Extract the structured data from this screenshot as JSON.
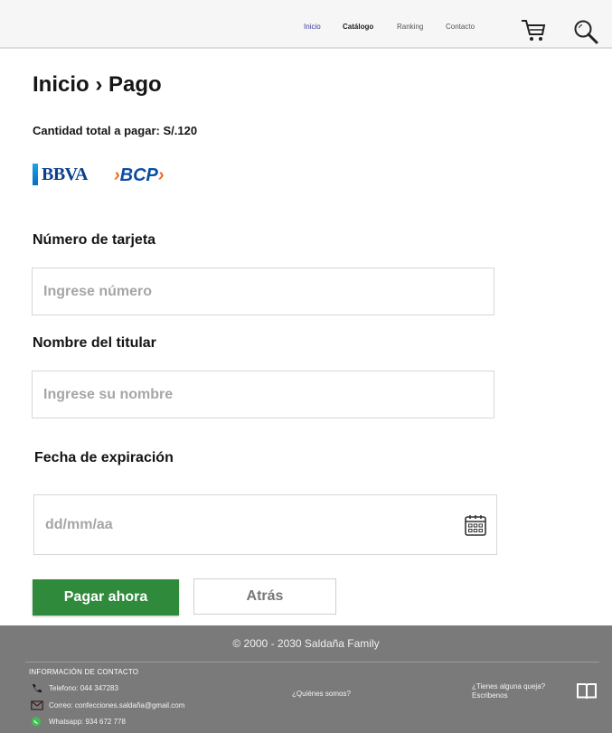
{
  "nav": {
    "items": [
      "Inicio",
      "Catálogo",
      "Ranking",
      "Contacto"
    ]
  },
  "main": {
    "breadcrumb": "Inicio › Pago",
    "total": "Cantidad total a pagar: S/.120",
    "banks": {
      "bbva": "BBVA",
      "bcp": "BCP"
    },
    "card_number": {
      "label": "Número de tarjeta",
      "placeholder": "Ingrese número"
    },
    "holder": {
      "label": "Nombre del titular",
      "placeholder": "Ingrese su nombre"
    },
    "expiry": {
      "label": "Fecha de expiración",
      "placeholder": "dd/mm/aa"
    },
    "pay_button": "Pagar ahora",
    "back_button": "Atrás"
  },
  "footer": {
    "copyright": "© 2000 - 2030 Saldaña Family",
    "contact_heading": "INFORMACIÓN DE CONTACTO",
    "phone": "Telefono: 044 347283",
    "email": "Correo: confecciones.saldaña@gmail.com",
    "whatsapp": "Whatsapp: 934 672 778",
    "about": "¿Quiénes somos?",
    "complaint_line1": "¿Tienes alguna queja?",
    "complaint_line2": "Escribenos"
  },
  "colors": {
    "accent_green": "#2f8a3c",
    "footer_bg": "#7a7a7a",
    "active_nav": "#3a3aa0",
    "bbva_blue": "#0b3f8c",
    "bcp_blue": "#0a4ea3",
    "bcp_orange": "#f26b21"
  },
  "icons": [
    "cart-icon",
    "search-icon",
    "calendar-icon",
    "phone-icon",
    "mail-icon",
    "whatsapp-icon",
    "book-icon"
  ]
}
